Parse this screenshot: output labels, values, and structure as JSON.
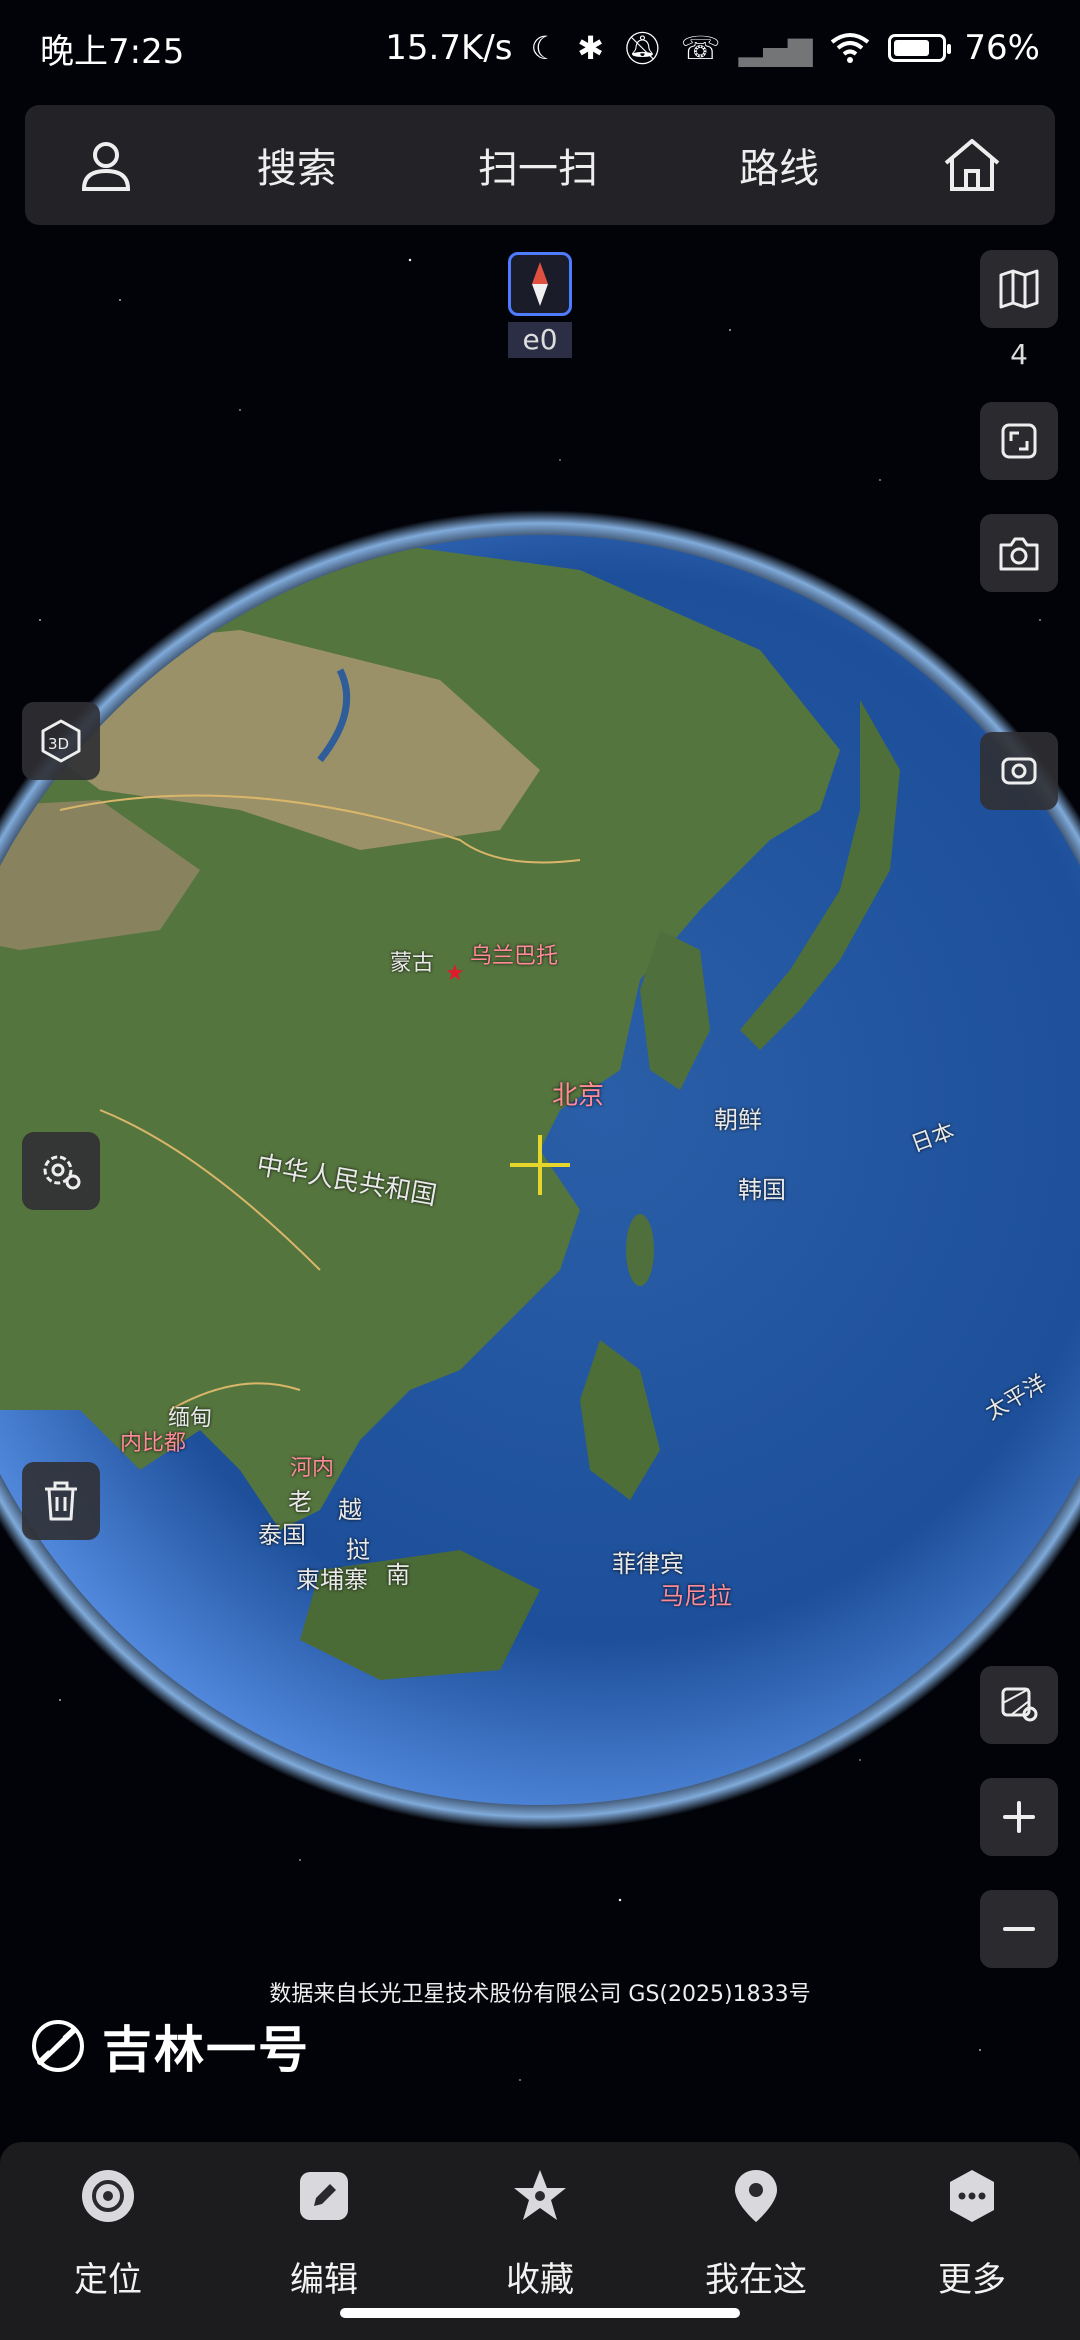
{
  "status_bar": {
    "time": "晚上7:25",
    "net_speed": "15.7K/s",
    "battery": "76%",
    "battery_level": 0.76
  },
  "top_nav": {
    "search": "搜索",
    "scan": "扫一扫",
    "route": "路线"
  },
  "compass": {
    "heading": "e0"
  },
  "layers": {
    "count": "4"
  },
  "left_tools": {
    "mode_3d": "3D"
  },
  "map": {
    "labels": {
      "mongolia": "蒙古",
      "ulaanbaatar": "乌兰巴托",
      "beijing": "北京",
      "china": "中华人民共和国",
      "north_korea": "朝鲜",
      "south_korea": "韩国",
      "japan": "日本",
      "pacific": "太平洋",
      "myanmar": "缅甸",
      "naypyidaw": "内比都",
      "hanoi": "河内",
      "laos_1": "老",
      "laos_2": "挝",
      "vietnam_1": "越",
      "vietnam_2": "南",
      "thailand": "泰国",
      "cambodia": "柬埔寨",
      "philippines": "菲律宾",
      "manila": "马尼拉"
    }
  },
  "attribution": "数据来自长光卫星技术股份有限公司 GS(2025)1833号",
  "brand": {
    "name": "吉林一号"
  },
  "bottom_nav": {
    "locate": "定位",
    "edit": "编辑",
    "favorite": "收藏",
    "here": "我在这",
    "more": "更多"
  },
  "colors": {
    "accent": "#4f7cff",
    "capital_marker": "#e0192b",
    "crosshair": "#e6d52a",
    "panel": "#26262a"
  }
}
